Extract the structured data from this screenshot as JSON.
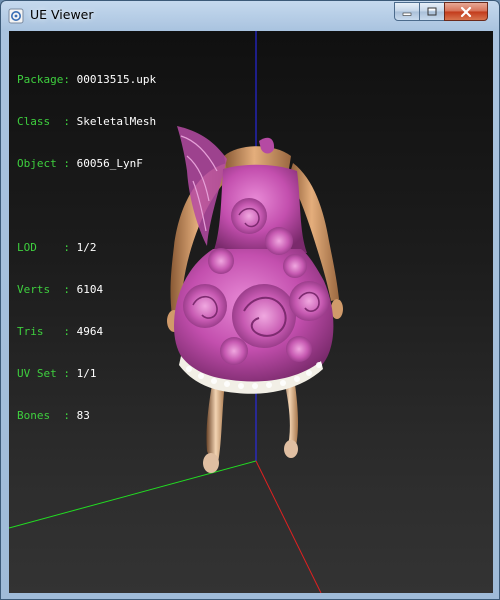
{
  "window": {
    "title": "UE Viewer",
    "app_icon": "ue-viewer-icon",
    "controls": {
      "minimize_icon": "minimize-icon",
      "maximize_icon": "maximize-icon",
      "close_icon": "close-icon"
    }
  },
  "info": {
    "package": {
      "label": "Package:",
      "value": "00013515.upk"
    },
    "class": {
      "label": "Class  :",
      "value": "SkeletalMesh"
    },
    "object": {
      "label": "Object :",
      "value": "60056_LynF"
    },
    "lod": {
      "label": "LOD    :",
      "value": "1/2"
    },
    "verts": {
      "label": "Verts  :",
      "value": "6104"
    },
    "tris": {
      "label": "Tris   :",
      "value": "4964"
    },
    "uvset": {
      "label": "UV Set :",
      "value": "1/1"
    },
    "bones": {
      "label": "Bones  :",
      "value": "83"
    }
  },
  "colors": {
    "label": "#3ecf3e",
    "value": "#ffffff",
    "axis_x": "#ff2020",
    "axis_y": "#20ff20",
    "axis_z": "#2020ff",
    "dress": "#c34fae",
    "skin": "#d9a070"
  }
}
